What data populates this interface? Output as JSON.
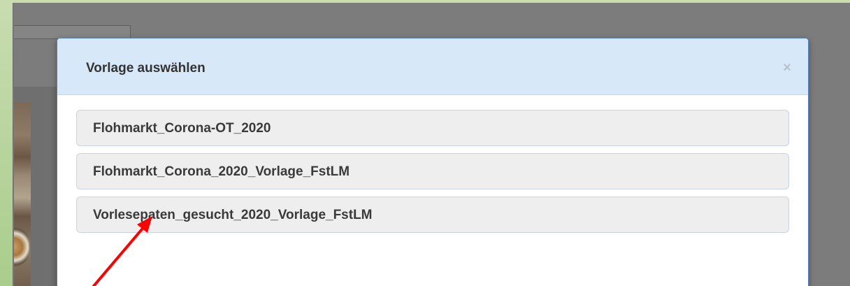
{
  "dialog": {
    "title": "Vorlage auswählen",
    "close_label": "×"
  },
  "templates": [
    {
      "label": "Flohmarkt_Corona-OT_2020"
    },
    {
      "label": "Flohmarkt_Corona_2020_Vorlage_FstLM"
    },
    {
      "label": "Vorlesepaten_gesucht_2020_Vorlage_FstLM"
    }
  ],
  "annotation": {
    "arrow_color": "#ff0000"
  }
}
